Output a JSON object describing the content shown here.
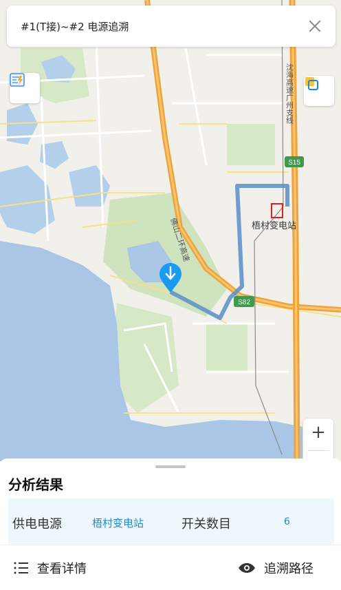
{
  "header": {
    "title": "#1(T接)~#2 电源追溯"
  },
  "map": {
    "station_label": "梧村变电站",
    "road_labels": {
      "expressway_right": "沈海高速广州支线",
      "expressway_left": "佛山二环高速",
      "badge_s15": "S15",
      "badge_s82": "S82"
    },
    "icons": {
      "layer_toggle": "power-layer-icon",
      "layer_switch": "layers-icon",
      "marker": "location-marker-icon"
    },
    "zoom_in_label": "+"
  },
  "panel": {
    "title": "分析结果",
    "power_source_label": "供电电源",
    "power_source_value": "梧村变电站",
    "switch_count_label": "开关数目",
    "switch_count_value": "6",
    "view_details_label": "查看详情",
    "trace_path_label": "追溯路径"
  },
  "colors": {
    "accent": "#1a8bd6",
    "route": "#5b8ec9",
    "expressway": "#f0a33a",
    "water": "#a9c6e6",
    "park": "#cfe3bf"
  }
}
